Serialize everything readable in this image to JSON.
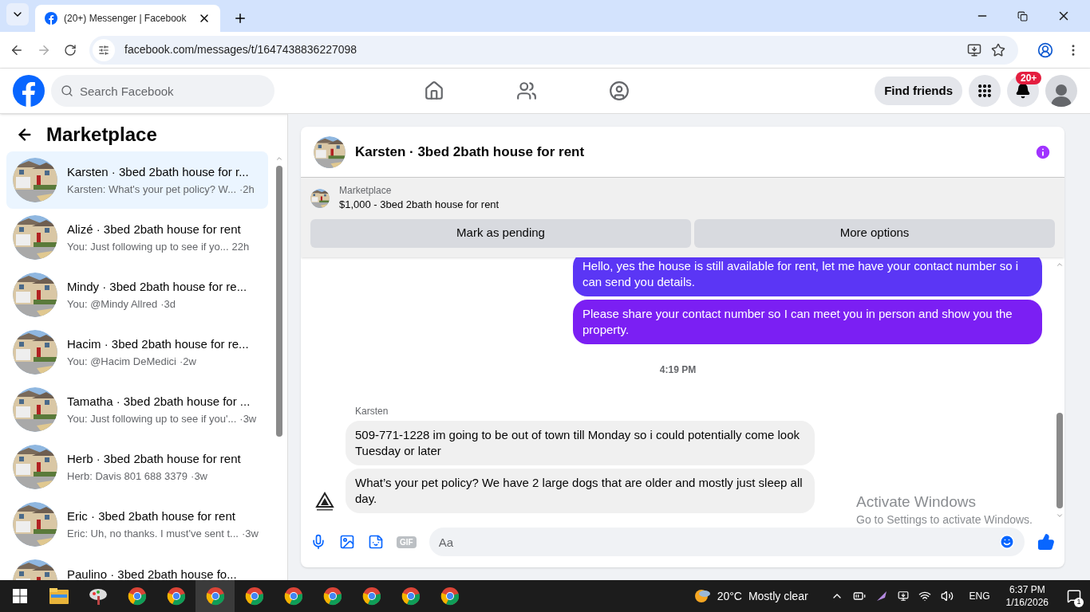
{
  "browser": {
    "tab_title": "(20+) Messenger | Facebook",
    "url": "facebook.com/messages/t/1647438836227098"
  },
  "header": {
    "search_placeholder": "Search Facebook",
    "find_friends": "Find friends",
    "notification_count": "20+"
  },
  "sidebar": {
    "title": "Marketplace",
    "conversations": [
      {
        "title": "Karsten · 3bed 2bath house for r...",
        "preview": "Karsten: What's your pet policy? W...",
        "time": "·2h",
        "selected": true
      },
      {
        "title": "Alizé · 3bed 2bath house for rent",
        "preview": "You: Just following up to see if yo...",
        "time": "22h",
        "selected": false
      },
      {
        "title": "Mindy · 3bed 2bath house for re...",
        "preview": "You: @Mindy Allred",
        "time": "·3d",
        "selected": false
      },
      {
        "title": "Hacim · 3bed 2bath house for re...",
        "preview": "You: @Hacim DeMedici",
        "time": "·2w",
        "selected": false
      },
      {
        "title": "Tamatha · 3bed 2bath house for ...",
        "preview": "You: Just following up to see if you'...",
        "time": "·3w",
        "selected": false
      },
      {
        "title": "Herb · 3bed 2bath house for rent",
        "preview": "Herb: Davis 801 688 3379",
        "time": "·3w",
        "selected": false
      },
      {
        "title": "Eric · 3bed 2bath house for rent",
        "preview": "Eric: Uh, no thanks. I must've sent t...",
        "time": "·3w",
        "selected": false
      },
      {
        "title": "Paulino · 3bed 2bath house fo...",
        "selected": false
      }
    ]
  },
  "chat": {
    "title": "Karsten · 3bed 2bath house for rent",
    "listing": {
      "label": "Marketplace",
      "item": "$1,000 - 3bed 2bath house for rent"
    },
    "buttons": [
      "Mark as pending",
      "More options"
    ],
    "messages": [
      {
        "kind": "outgoing",
        "text": "Hello, yes the house is still available for rent, let me have your contact number so i can send you details."
      },
      {
        "kind": "outgoing",
        "text": "Please share your contact number so I can meet you in person and show you the property."
      },
      {
        "kind": "timestamp",
        "text": "4:19 PM"
      },
      {
        "kind": "sender",
        "text": "Karsten"
      },
      {
        "kind": "incoming",
        "text": "509-771-1228 im going to be out of town till Monday so i could potentially come look Tuesday or later"
      },
      {
        "kind": "incoming",
        "text": "What’s your pet policy? We have 2 large dogs that are older and mostly just sleep all day."
      }
    ],
    "gif_label": "GIF",
    "input_placeholder": "Aa"
  },
  "activation_notice": {
    "title": "Activate Windows",
    "subtitle": "Go to Settings to activate Windows."
  },
  "taskbar": {
    "temperature": "20°C",
    "weather": "Mostly clear",
    "language": "ENG",
    "time": "6:37 PM",
    "date": "1/16/2026",
    "notifications": "1"
  }
}
